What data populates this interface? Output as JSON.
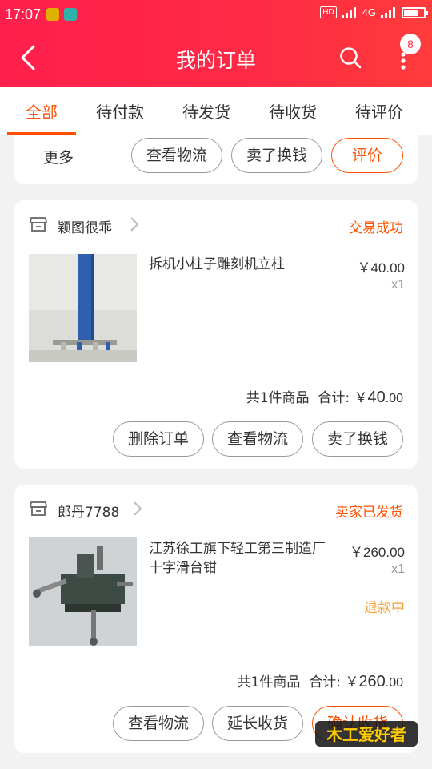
{
  "status_bar": {
    "time": "17:07",
    "network": "4G",
    "hd": "HD",
    "net_small": "4G"
  },
  "header": {
    "title": "我的订单",
    "badge_count": "8",
    "back_icon": "chevron-left-icon",
    "search_icon": "search-icon",
    "more_icon": "more-vertical-icon",
    "gradient_start": "#ff1f4d",
    "gradient_end": "#ff3b3b"
  },
  "tabs": [
    {
      "label": "全部",
      "active": true
    },
    {
      "label": "待付款"
    },
    {
      "label": "待发货"
    },
    {
      "label": "待收货"
    },
    {
      "label": "待评价"
    }
  ],
  "colors": {
    "accent": "#ff5000",
    "refund": "#f2a23a"
  },
  "partial_card": {
    "more_label": "更多",
    "buttons": [
      "查看物流",
      "卖了换钱",
      "评价"
    ]
  },
  "orders": [
    {
      "shop": "颖图很乖",
      "status": "交易成功",
      "product": "拆机小柱子雕刻机立柱",
      "price": "￥40.00",
      "qty": "x1",
      "count_text": "共1件商品",
      "total_label": "合计:",
      "total_currency": "￥",
      "total_int": "40",
      "total_dec": ".00",
      "buttons": [
        "删除订单",
        "查看物流",
        "卖了换钱"
      ]
    },
    {
      "shop": "郎丹7788",
      "status": "卖家已发货",
      "product": "江苏徐工旗下轻工第三制造厂十字滑台钳",
      "price": "￥260.00",
      "qty": "x1",
      "refund": "退款中",
      "count_text": "共1件商品",
      "total_label": "合计:",
      "total_currency": "￥",
      "total_int": "260",
      "total_dec": ".00",
      "buttons": [
        "查看物流",
        "延长收货",
        "确认收货"
      ]
    }
  ],
  "watermark": {
    "text": "木工爱好者"
  }
}
